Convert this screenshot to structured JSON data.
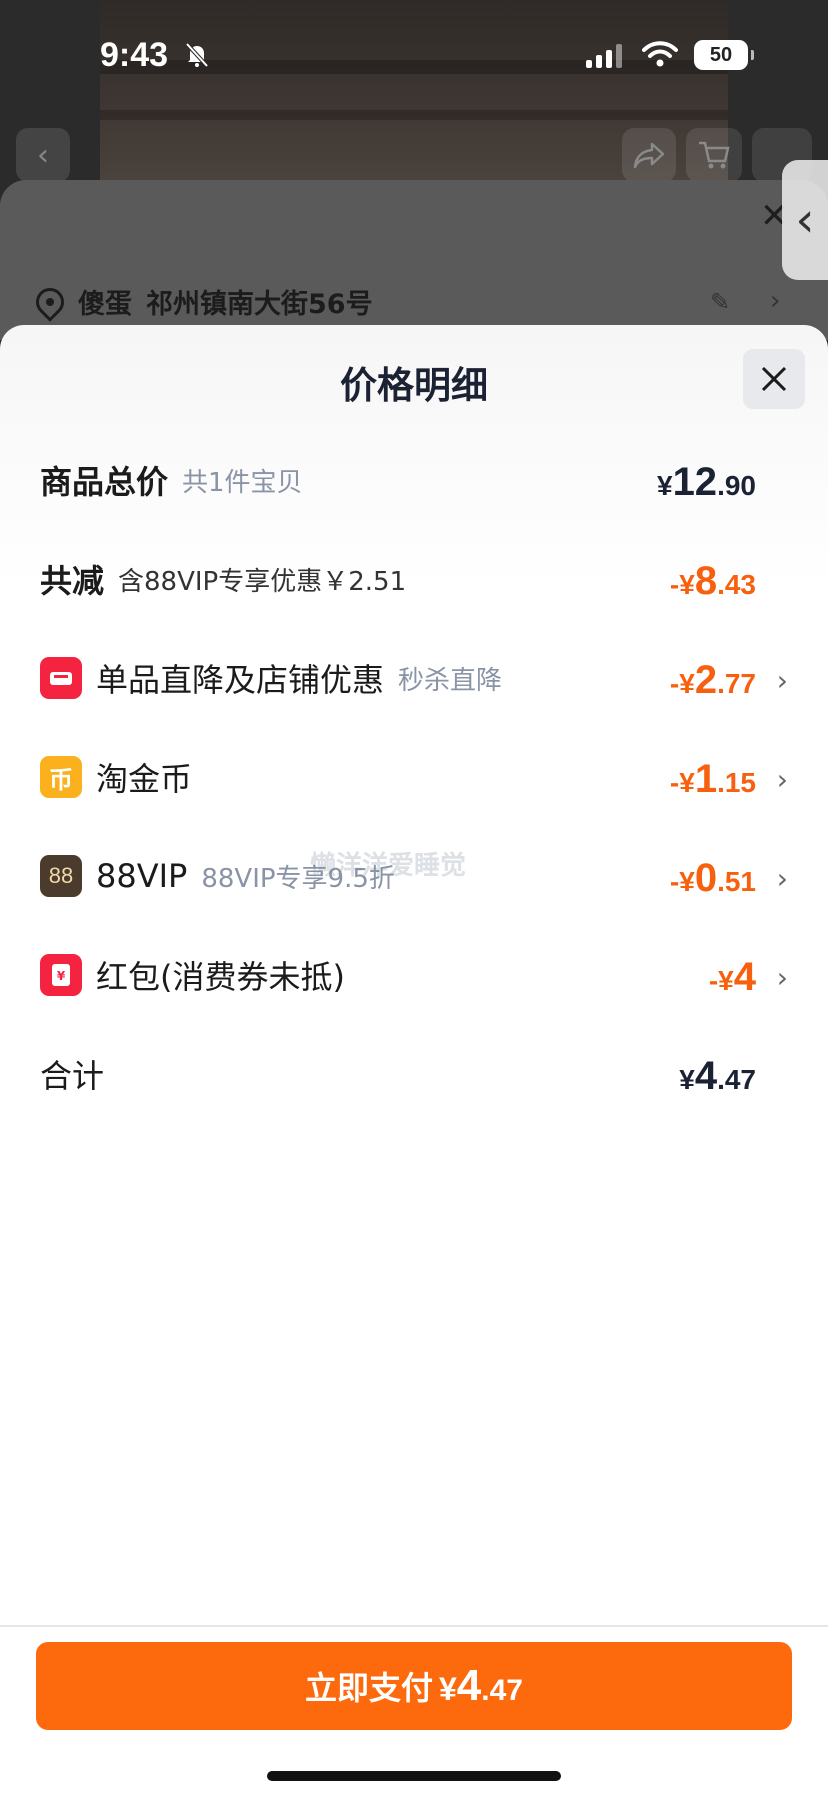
{
  "status_bar": {
    "time": "9:43",
    "battery": "50"
  },
  "background": {
    "address_name": "傻蛋",
    "address_text": "祁州镇南大街56号"
  },
  "sheet": {
    "title": "价格明细",
    "rows": {
      "total": {
        "label": "商品总价",
        "sub": "共1件宝贝",
        "currency": "¥",
        "int": "12",
        "dec": ".90"
      },
      "discount": {
        "label": "共减",
        "sub": "含88VIP专享优惠￥2.51",
        "currency": "-¥",
        "int": "8",
        "dec": ".43"
      },
      "shop": {
        "label": "单品直降及店铺优惠",
        "sub": "秒杀直降",
        "currency": "-¥",
        "int": "2",
        "dec": ".77"
      },
      "coin": {
        "label": "淘金币",
        "icon_text": "币",
        "currency": "-¥",
        "int": "1",
        "dec": ".15"
      },
      "vip": {
        "label": "88VIP",
        "sub": "88VIP专享9.5折",
        "icon_text": "88",
        "currency": "-¥",
        "int": "0",
        "dec": ".51"
      },
      "redpack": {
        "label": "红包(消费券未抵)",
        "currency": "-¥",
        "int": "4",
        "dec": ""
      },
      "sum": {
        "label": "合计",
        "currency": "¥",
        "int": "4",
        "dec": ".47"
      }
    },
    "watermark": "懒洋洋爱睡觉"
  },
  "pay_button": {
    "label": "立即支付",
    "currency": "¥",
    "int": "4",
    "dec": ".47"
  },
  "colors": {
    "accent": "#fd6a0d",
    "discount": "#f7600e",
    "red_icon": "#f4233f",
    "gold_icon": "#fbb11d"
  },
  "icons": [
    "chevron-left-icon",
    "share-icon",
    "cart-icon",
    "close-icon",
    "location-pin-icon",
    "edit-icon",
    "chevron-right-icon",
    "shop-icon",
    "coin-icon",
    "vip-icon",
    "red-packet-icon"
  ]
}
